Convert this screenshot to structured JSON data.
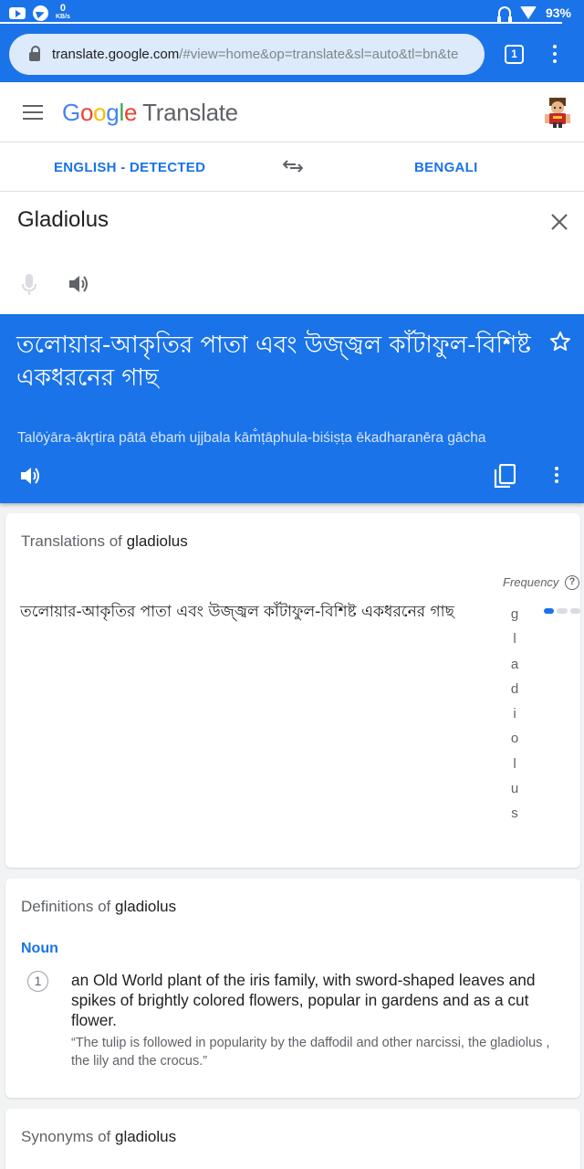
{
  "status_bar": {
    "speed_value": "0",
    "speed_unit": "KB/s",
    "battery": "93%"
  },
  "browser": {
    "url_host": "translate.google.com",
    "url_rest": "/#view=home&op=translate&sl=auto&tl=bn&te",
    "tab_count": "1"
  },
  "app": {
    "logo_letters": [
      "G",
      "o",
      "o",
      "g",
      "l",
      "e"
    ],
    "product": "Translate"
  },
  "languages": {
    "source": "ENGLISH - DETECTED",
    "target": "BENGALI"
  },
  "input": {
    "text": "Gladiolus"
  },
  "translation": {
    "text": "তলোয়ার-আকৃতির পাতা এবং উজ্জ্বল কাঁটাফুল-বিশিষ্ট একধরনের গাছ",
    "transliteration": "Talōẏāra-ākr̥tira pātā ēbaṁ ujjbala kām̐ṭāphula-biśiṣṭa ēkadharanēra gācha"
  },
  "translations_card": {
    "title_prefix": "Translations of",
    "word": "gladiolus",
    "frequency_label": "Frequency",
    "help": "?",
    "row_text": "তলোয়ার-আকৃতির পাতা এবং উজ্জ্বল কাঁটাফুল-বিশিষ্ট একধরনের গাছ",
    "vertical_word": [
      "g",
      "l",
      "a",
      "d",
      "i",
      "o",
      "l",
      "u",
      "s"
    ],
    "frequency_level": 1,
    "frequency_max": 3
  },
  "definitions_card": {
    "title_prefix": "Definitions of",
    "word": "gladiolus",
    "part_of_speech": "Noun",
    "number": "1",
    "definition": "an Old World plant of the iris family, with sword-shaped leaves and spikes of brightly colored flowers, popular in gardens and as a cut flower.",
    "example": "“The tulip is followed in popularity by the daffodil and other narcissi, the gladiolus , the lily and the crocus.”"
  },
  "synonyms_card": {
    "title_prefix": "Synonyms of",
    "word": "gladiolus"
  },
  "colors": {
    "accent": "#1a73e8"
  }
}
